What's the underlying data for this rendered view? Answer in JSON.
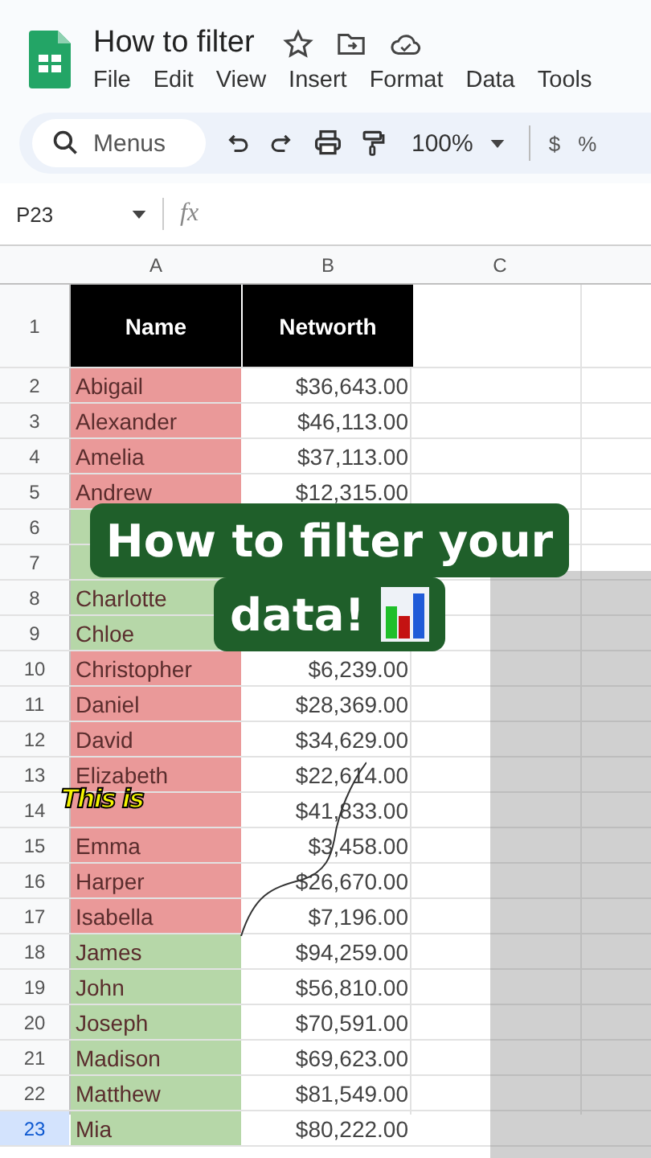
{
  "document": {
    "title": "How to filter",
    "menus": [
      "File",
      "Edit",
      "View",
      "Insert",
      "Format",
      "Data",
      "Tools"
    ]
  },
  "toolbar": {
    "search_placeholder": "Menus",
    "zoom": "100%",
    "currency": "$",
    "percent": "%"
  },
  "formula_bar": {
    "cell_ref": "P23",
    "fx": "fx"
  },
  "sheet": {
    "columns": [
      "A",
      "B",
      "C"
    ],
    "header_row": "1",
    "headers": [
      "Name",
      "Networth"
    ],
    "rows": [
      {
        "number": "2",
        "name": "Abigail",
        "networth": "$36,643.00",
        "color": "#ea9999",
        "selected": false
      },
      {
        "number": "3",
        "name": "Alexander",
        "networth": "$46,113.00",
        "color": "#ea9999",
        "selected": false
      },
      {
        "number": "4",
        "name": "Amelia",
        "networth": "$37,113.00",
        "color": "#ea9999",
        "selected": false
      },
      {
        "number": "5",
        "name": "Andrew",
        "networth": "$12,315.00",
        "color": "#ea9999",
        "selected": false
      },
      {
        "number": "6",
        "color": "#b6d7a8",
        "selected": false
      },
      {
        "number": "7",
        "color": "#b6d7a8",
        "selected": false
      },
      {
        "number": "8",
        "name": "Charlotte",
        "color": "#b6d7a8",
        "selected": false
      },
      {
        "number": "9",
        "name": "Chloe",
        "color": "#b6d7a8",
        "selected": false
      },
      {
        "number": "10",
        "name": "Christopher",
        "networth": "$6,239.00",
        "color": "#ea9999",
        "selected": false
      },
      {
        "number": "11",
        "name": "Daniel",
        "networth": "$28,369.00",
        "color": "#ea9999",
        "selected": false
      },
      {
        "number": "12",
        "name": "David",
        "networth": "$34,629.00",
        "color": "#ea9999",
        "selected": false
      },
      {
        "number": "13",
        "name": "Elizabeth",
        "networth": "$22,614.00",
        "color": "#ea9999",
        "selected": false
      },
      {
        "number": "14",
        "networth": "$41,833.00",
        "color": "#ea9999",
        "selected": false
      },
      {
        "number": "15",
        "name": "Emma",
        "networth": "$3,458.00",
        "color": "#ea9999",
        "selected": false
      },
      {
        "number": "16",
        "name": "Harper",
        "networth": "$26,670.00",
        "color": "#ea9999",
        "selected": false
      },
      {
        "number": "17",
        "name": "Isabella",
        "networth": "$7,196.00",
        "color": "#ea9999",
        "selected": false
      },
      {
        "number": "18",
        "name": "James",
        "networth": "$94,259.00",
        "color": "#b6d7a8",
        "selected": false
      },
      {
        "number": "19",
        "name": "John",
        "networth": "$56,810.00",
        "color": "#b6d7a8",
        "selected": false
      },
      {
        "number": "20",
        "name": "Joseph",
        "networth": "$70,591.00",
        "color": "#b6d7a8",
        "selected": false
      },
      {
        "number": "21",
        "name": "Madison",
        "networth": "$69,623.00",
        "color": "#b6d7a8",
        "selected": false
      },
      {
        "number": "22",
        "name": "Matthew",
        "networth": "$81,549.00",
        "color": "#b6d7a8",
        "selected": false
      },
      {
        "number": "23",
        "name": "Mia",
        "networth": "$80,222.00",
        "color": "#b6d7a8",
        "selected": true
      }
    ]
  },
  "captions": [
    {
      "kind": "title",
      "lines": [
        "How to filter your",
        "data!"
      ]
    },
    {
      "kind": "subtitle",
      "lines": [
        "This is"
      ]
    }
  ]
}
